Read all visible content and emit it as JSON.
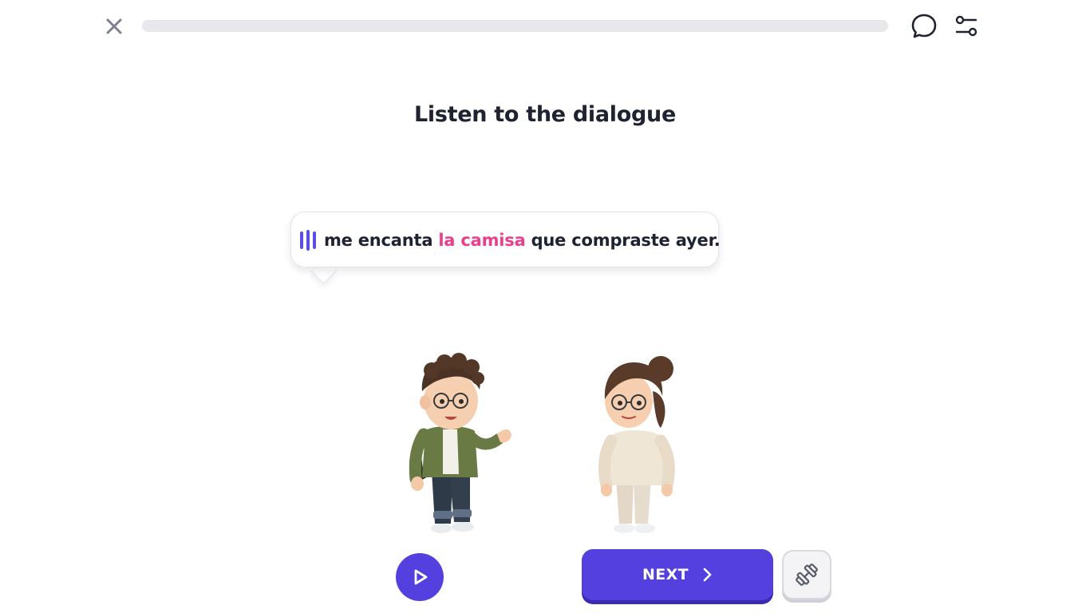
{
  "topbar": {
    "close_icon": "close-icon",
    "progress": 0,
    "chat_icon": "chat-bubble-icon",
    "settings_icon": "sliders-icon"
  },
  "title": "Listen to the dialogue",
  "dialogue": {
    "audio_icon": "sound-bars-icon",
    "before": [
      "me",
      "encanta"
    ],
    "highlight": "la camisa",
    "after": "que compraste ayer.",
    "highlight_color": "#ea3f8b"
  },
  "characters": [
    "boy-character",
    "girl-character"
  ],
  "controls": {
    "play_icon": "play-icon",
    "next_label": "NEXT",
    "next_icon": "chevron-right-icon",
    "practice_icon": "dumbbell-icon"
  },
  "colors": {
    "accent": "#5340df",
    "progress_track": "#e7e7ec",
    "text": "#1f2230"
  }
}
